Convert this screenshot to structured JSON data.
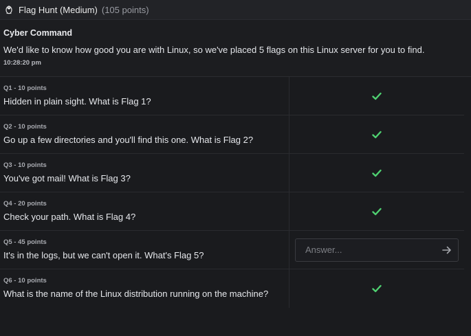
{
  "header": {
    "title": "Flag Hunt (Medium)",
    "points": "(105 points)",
    "icon": "linux-penguin-icon"
  },
  "intro": {
    "author": "Cyber Command",
    "description": "We'd like to know how good you are with Linux, so we've placed 5 flags on this Linux server for you to find.",
    "time": "10:28:20 pm"
  },
  "questions": [
    {
      "label": "Q1 - 10 points",
      "text": "Hidden in plain sight. What is Flag 1?",
      "status": "solved"
    },
    {
      "label": "Q2 - 10 points",
      "text": "Go up a few directories and you'll find this one. What is Flag 2?",
      "status": "solved"
    },
    {
      "label": "Q3 - 10 points",
      "text": "You've got mail! What is Flag 3?",
      "status": "solved"
    },
    {
      "label": "Q4 - 20 points",
      "text": "Check your path. What is Flag 4?",
      "status": "solved"
    },
    {
      "label": "Q5 - 45 points",
      "text": "It's in the logs, but we can't open it. What's Flag 5?",
      "status": "open",
      "placeholder": "Answer..."
    },
    {
      "label": "Q6 - 10 points",
      "text": "What is the name of the Linux distribution running on the machine?",
      "status": "solved"
    }
  ],
  "colors": {
    "check": "#4fd171",
    "background": "#1a1b1e"
  }
}
